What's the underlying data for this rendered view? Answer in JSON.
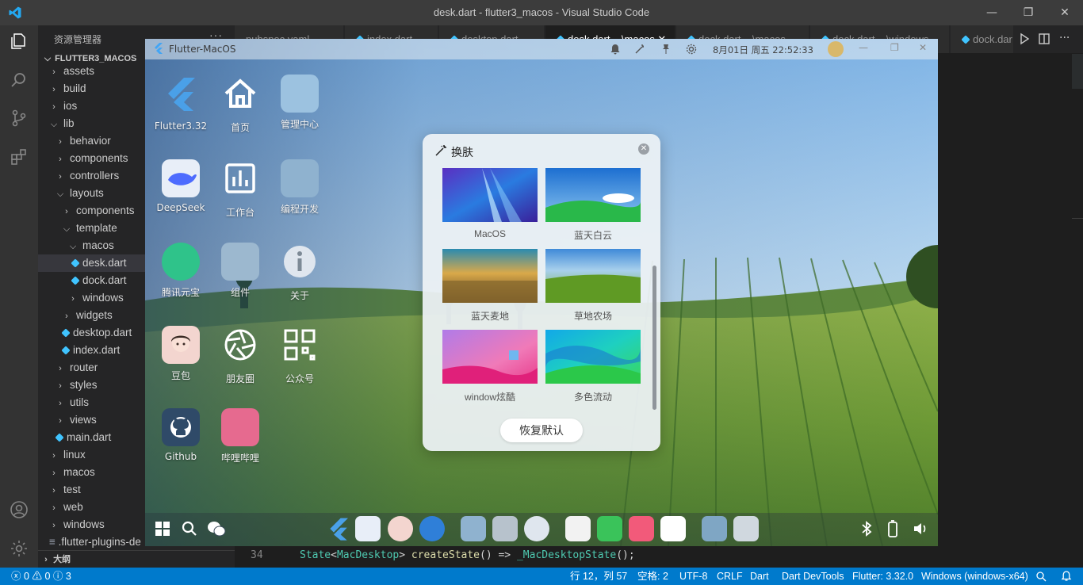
{
  "window": {
    "title": "desk.dart - flutter3_macos - Visual Studio Code",
    "minimize": "—",
    "restore": "❐",
    "close": "✕"
  },
  "sidebar": {
    "header": "资源管理器",
    "more": "···",
    "root": "FLUTTER3_MACOS",
    "items": [
      {
        "label": "assets",
        "depth": 0,
        "kind": "folder",
        "open": false
      },
      {
        "label": "build",
        "depth": 0,
        "kind": "folder",
        "open": false
      },
      {
        "label": "ios",
        "depth": 0,
        "kind": "folder",
        "open": false
      },
      {
        "label": "lib",
        "depth": 0,
        "kind": "folder",
        "open": true
      },
      {
        "label": "behavior",
        "depth": 1,
        "kind": "folder",
        "open": false
      },
      {
        "label": "components",
        "depth": 1,
        "kind": "folder",
        "open": false
      },
      {
        "label": "controllers",
        "depth": 1,
        "kind": "folder",
        "open": false
      },
      {
        "label": "layouts",
        "depth": 1,
        "kind": "folder",
        "open": true
      },
      {
        "label": "components",
        "depth": 2,
        "kind": "folder",
        "open": false
      },
      {
        "label": "template",
        "depth": 2,
        "kind": "folder",
        "open": true
      },
      {
        "label": "macos",
        "depth": 3,
        "kind": "folder",
        "open": true
      },
      {
        "label": "desk.dart",
        "depth": 4,
        "kind": "dart",
        "selected": true
      },
      {
        "label": "dock.dart",
        "depth": 4,
        "kind": "dart"
      },
      {
        "label": "windows",
        "depth": 3,
        "kind": "folder",
        "open": false
      },
      {
        "label": "widgets",
        "depth": 2,
        "kind": "folder",
        "open": false
      },
      {
        "label": "desktop.dart",
        "depth": 2,
        "kind": "dart"
      },
      {
        "label": "index.dart",
        "depth": 2,
        "kind": "dart"
      },
      {
        "label": "router",
        "depth": 1,
        "kind": "folder",
        "open": false
      },
      {
        "label": "styles",
        "depth": 1,
        "kind": "folder",
        "open": false
      },
      {
        "label": "utils",
        "depth": 1,
        "kind": "folder",
        "open": false
      },
      {
        "label": "views",
        "depth": 1,
        "kind": "folder",
        "open": false
      },
      {
        "label": "main.dart",
        "depth": 1,
        "kind": "dart"
      },
      {
        "label": "linux",
        "depth": 0,
        "kind": "folder",
        "open": false
      },
      {
        "label": "macos",
        "depth": 0,
        "kind": "folder",
        "open": false
      },
      {
        "label": "test",
        "depth": 0,
        "kind": "folder",
        "open": false
      },
      {
        "label": "web",
        "depth": 0,
        "kind": "folder",
        "open": false
      },
      {
        "label": "windows",
        "depth": 0,
        "kind": "folder",
        "open": false
      },
      {
        "label": ".flutter-plugins-de",
        "depth": 0,
        "kind": "file"
      }
    ],
    "outline": "大纲"
  },
  "tabs": [
    {
      "label": "pubspec.yaml",
      "active": false
    },
    {
      "label": "index.dart",
      "active": false
    },
    {
      "label": "desktop.dart",
      "active": false
    },
    {
      "label": "desk.dart ...\\macos ✕",
      "active": true
    },
    {
      "label": "dock.dart ...\\macos",
      "active": false
    },
    {
      "label": "dock.dart ...\\windows",
      "active": false
    },
    {
      "label": "dock.dar",
      "active": false
    }
  ],
  "code": {
    "line_number": "34",
    "tokens": [
      "State",
      "<",
      "MacDesktop",
      "> ",
      "createState",
      "() => ",
      "_MacDesktopState",
      "();"
    ]
  },
  "app": {
    "title": "Flutter-MacOS",
    "datetime": "8月01日 周五 22:52:33",
    "icons": [
      {
        "label": "Flutter3.32",
        "icon": "flutter-icon"
      },
      {
        "label": "首页",
        "icon": "home-icon"
      },
      {
        "label": "管理中心",
        "icon": "admin-icon"
      },
      {
        "label": "DeepSeek",
        "icon": "deepseek-icon"
      },
      {
        "label": "工作台",
        "icon": "chart-icon"
      },
      {
        "label": "编程开发",
        "icon": "apps-icon"
      },
      {
        "label": "腾讯元宝",
        "icon": "yuanbao-icon"
      },
      {
        "label": "组件",
        "icon": "widget-icon"
      },
      {
        "label": "关于",
        "icon": "info-icon"
      },
      {
        "label": "豆包",
        "icon": "doubao-icon"
      },
      {
        "label": "朋友圈",
        "icon": "aperture-icon"
      },
      {
        "label": "公众号",
        "icon": "qrcode-icon"
      },
      {
        "label": "Github",
        "icon": "github-icon"
      },
      {
        "label": "哔哩哔哩",
        "icon": "bilibili-icon"
      }
    ]
  },
  "dialog": {
    "title": "换肤",
    "restore": "恢复默认",
    "skins": [
      {
        "label": "MacOS"
      },
      {
        "label": "蓝天白云"
      },
      {
        "label": "蓝天麦地"
      },
      {
        "label": "草地农场"
      },
      {
        "label": "window炫酷"
      },
      {
        "label": "多色流动"
      }
    ]
  },
  "status": {
    "errors": "0",
    "warnings": "0",
    "info": "3",
    "position": "行 12，列 57",
    "spaces": "空格: 2",
    "encoding": "UTF-8",
    "eol": "CRLF",
    "language": "Dart",
    "devtools": "Dart DevTools",
    "flutter": "Flutter: 3.32.0",
    "device": "Windows (windows-x64)"
  },
  "colors": {
    "accent": "#007acc",
    "titlebar": "#3c3c3c",
    "sidebar": "#252526",
    "editor": "#1e1e1e"
  }
}
